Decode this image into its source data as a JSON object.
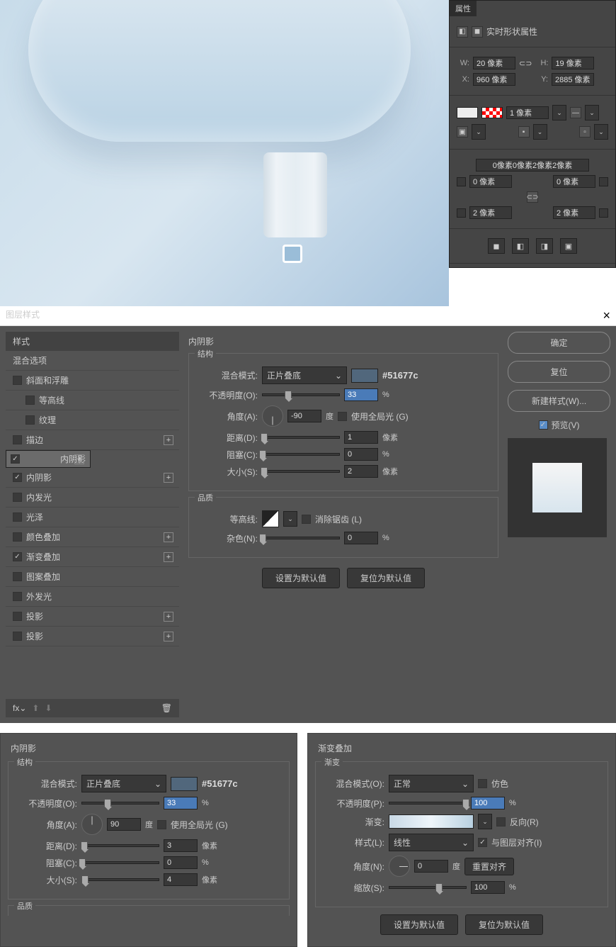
{
  "props": {
    "tab": "属性",
    "title": "实时形状属性",
    "w_lbl": "W:",
    "w": "20 像素",
    "h_lbl": "H:",
    "h": "19 像素",
    "x_lbl": "X:",
    "x": "960 像素",
    "y_lbl": "Y:",
    "y": "2885 像素",
    "stroke": "1 像素",
    "corners": "0像素0像素2像素2像素",
    "c1": "0 像素",
    "c2": "0 像素",
    "c3": "2 像素",
    "c4": "2 像素"
  },
  "dlg": {
    "title": "图层样式"
  },
  "styles": {
    "hd": "样式",
    "blend": "混合选项",
    "items": [
      {
        "label": "斜面和浮雕",
        "on": false,
        "plus": false
      },
      {
        "label": "等高线",
        "on": false,
        "sub": true
      },
      {
        "label": "纹理",
        "on": false,
        "sub": true
      },
      {
        "label": "描边",
        "on": false,
        "plus": true
      },
      {
        "label": "内阴影",
        "on": true,
        "plus": true,
        "sel": true
      },
      {
        "label": "内阴影",
        "on": true,
        "plus": true
      },
      {
        "label": "内发光",
        "on": false
      },
      {
        "label": "光泽",
        "on": false
      },
      {
        "label": "颜色叠加",
        "on": false,
        "plus": true
      },
      {
        "label": "渐变叠加",
        "on": true,
        "plus": true
      },
      {
        "label": "图案叠加",
        "on": false
      },
      {
        "label": "外发光",
        "on": false
      },
      {
        "label": "投影",
        "on": false,
        "plus": true
      },
      {
        "label": "投影",
        "on": false,
        "plus": true
      }
    ]
  },
  "inner1": {
    "title": "内阴影",
    "struct": "结构",
    "blend_lbl": "混合模式:",
    "blend": "正片叠底",
    "hex": "#51677c",
    "opacity_lbl": "不透明度(O):",
    "opacity": "33",
    "opacity_u": "%",
    "angle_lbl": "角度(A):",
    "angle": "-90",
    "angle_u": "度",
    "global": "使用全局光 (G)",
    "dist_lbl": "距离(D):",
    "dist": "1",
    "dist_u": "像素",
    "choke_lbl": "阻塞(C):",
    "choke": "0",
    "choke_u": "%",
    "size_lbl": "大小(S):",
    "size": "2",
    "size_u": "像素",
    "quality": "品质",
    "contour_lbl": "等高线:",
    "anti": "消除锯齿 (L)",
    "noise_lbl": "杂色(N):",
    "noise": "0",
    "noise_u": "%",
    "default": "设置为默认值",
    "reset": "复位为默认值"
  },
  "right": {
    "ok": "确定",
    "cancel": "复位",
    "new": "新建样式(W)...",
    "preview": "预览(V)"
  },
  "inner2": {
    "title": "内阴影",
    "struct": "结构",
    "blend_lbl": "混合模式:",
    "blend": "正片叠底",
    "hex": "#51677c",
    "opacity_lbl": "不透明度(O):",
    "opacity": "33",
    "opacity_u": "%",
    "angle_lbl": "角度(A):",
    "angle": "90",
    "angle_u": "度",
    "global": "使用全局光 (G)",
    "dist_lbl": "距离(D):",
    "dist": "3",
    "dist_u": "像素",
    "choke_lbl": "阻塞(C):",
    "choke": "0",
    "choke_u": "%",
    "size_lbl": "大小(S):",
    "size": "4",
    "size_u": "像素",
    "quality": "品质"
  },
  "grad": {
    "title": "渐变叠加",
    "sec": "渐变",
    "blend_lbl": "混合模式(O):",
    "blend": "正常",
    "dither": "仿色",
    "opacity_lbl": "不透明度(P):",
    "opacity": "100",
    "opacity_u": "%",
    "grad_lbl": "渐变:",
    "reverse": "反向(R)",
    "style_lbl": "样式(L):",
    "style": "线性",
    "align": "与图层对齐(I)",
    "angle_lbl": "角度(N):",
    "angle": "0",
    "angle_u": "度",
    "reset_align": "重置对齐",
    "scale_lbl": "缩放(S):",
    "scale": "100",
    "scale_u": "%",
    "default": "设置为默认值",
    "reset": "复位为默认值"
  }
}
